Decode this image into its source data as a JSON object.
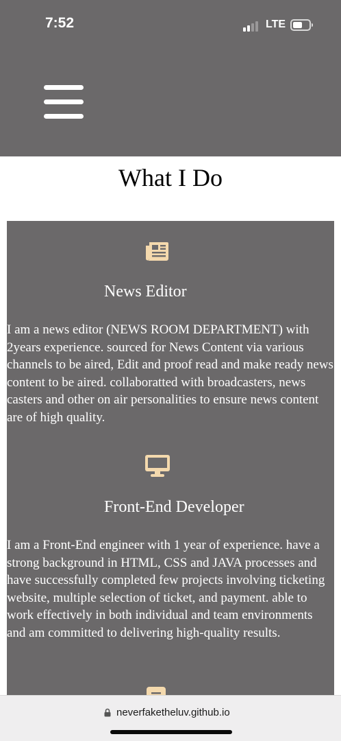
{
  "status_bar": {
    "time": "7:52",
    "network": "LTE",
    "signal_bars_active": 2,
    "signal_bars_total": 4,
    "battery_level": 0.4
  },
  "header": {
    "menu_icon": "hamburger-menu-icon",
    "background": "#6b696a"
  },
  "section": {
    "title": "What I Do"
  },
  "services": [
    {
      "icon": "newspaper-icon",
      "title": "News Editor",
      "description": "I am a news editor (NEWS ROOM DEPARTMENT) with 2years experience. sourced for News Content via various channels to be aired, Edit and proof read and make ready news content to be aired. collaboratted with broadcasters, news casters and other on air personalities to ensure news content are of high quality."
    },
    {
      "icon": "desktop-monitor-icon",
      "title": "Front-End Developer",
      "description": "I am a Front-End engineer with 1 year of experience. have a strong background in HTML, CSS and JAVA processes and have successfully completed few projects involving ticketing website, multiple selection of ticket, and payment. able to work effectively in both individual and team environments and am committed to delivering high-quality results."
    },
    {
      "icon": "document-icon"
    }
  ],
  "browser": {
    "url": "neverfaketheluv.github.io",
    "lock_icon": "lock-icon"
  },
  "colors": {
    "panel": "#6b696a",
    "icon_accent": "#f4d9ad",
    "text_on_panel": "#ffffff"
  }
}
